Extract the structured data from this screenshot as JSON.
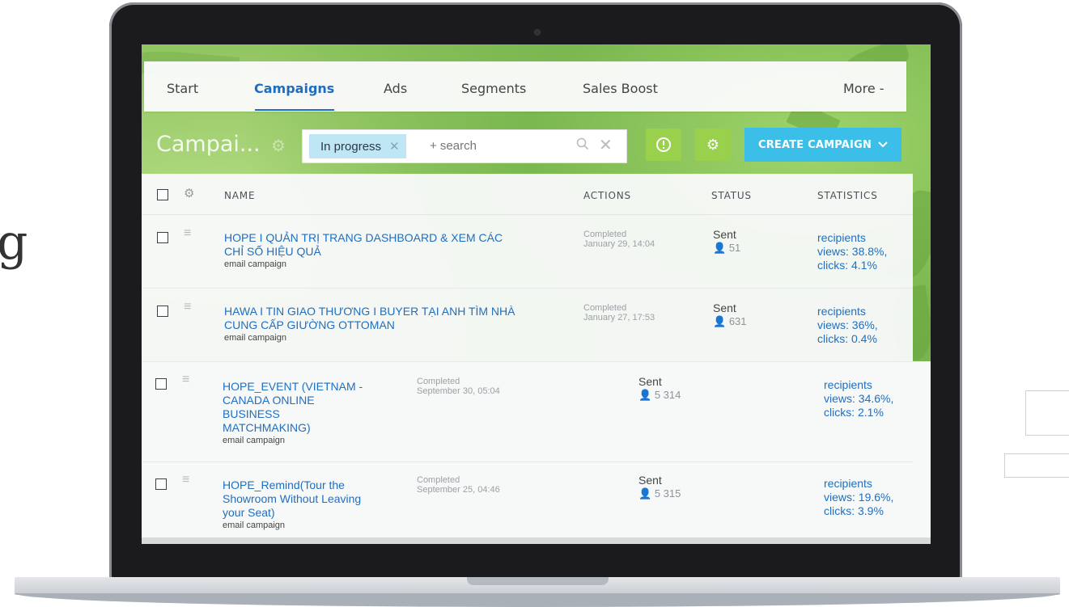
{
  "side_text": "g",
  "nav": {
    "items": [
      {
        "label": "Start"
      },
      {
        "label": "Campaigns"
      },
      {
        "label": "Ads"
      },
      {
        "label": "Segments"
      },
      {
        "label": "Sales Boost"
      },
      {
        "label": "More -"
      }
    ]
  },
  "header": {
    "title": "Campai...",
    "filter_chip": "In progress",
    "search_placeholder": "+ search",
    "create_button": "CREATE CAMPAIGN"
  },
  "table": {
    "columns": [
      "NAME",
      "ACTIONS",
      "STATUS",
      "STATISTICS"
    ],
    "rows": [
      {
        "name_line1": "HOPE I QUẢN TRỊ TRANG DASHBOARD & XEM CÁC",
        "name_line2": "CHỈ SỐ HIỆU QUẢ",
        "type": "email campaign",
        "action_status": "Completed",
        "action_date": "January 29, 14:04",
        "status": "Sent",
        "count": "51",
        "stat1": "recipients",
        "stat2": "views: 38.8%,",
        "stat3": "clicks: 4.1%"
      },
      {
        "name_line1": "HAWA I TIN GIAO THƯƠNG I BUYER TẠI ANH TÌM NHÀ",
        "name_line2": "CUNG CẤP GIƯỜNG OTTOMAN",
        "type": "email campaign",
        "action_status": "Completed",
        "action_date": "January 27, 17:53",
        "status": "Sent",
        "count": "631",
        "stat1": "recipients",
        "stat2": "views: 36%,",
        "stat3": "clicks: 0.4%"
      },
      {
        "name_line1": "HOPE_EVENT (VIETNAM -",
        "name_line2": "CANADA ONLINE",
        "name_line3": "BUSINESS",
        "name_line4": "MATCHMAKING)",
        "type": "email campaign",
        "action_status": "Completed",
        "action_date": "September 30, 05:04",
        "status": "Sent",
        "count": "5 314",
        "stat1": "recipients",
        "stat2": "views: 34.6%,",
        "stat3": "clicks: 2.1%"
      },
      {
        "name_line1": "HOPE_Remind(Tour the",
        "name_line2": "Showroom Without Leaving",
        "name_line3": "your Seat)",
        "type": "email campaign",
        "action_status": "Completed",
        "action_date": "September 25, 04:46",
        "status": "Sent",
        "count": "5 315",
        "stat1": "recipients",
        "stat2": "views: 19.6%,",
        "stat3": "clicks: 3.9%"
      }
    ]
  },
  "colors": {
    "accent": "#1d6ec2",
    "create_button": "#3bbfe8",
    "green_button": "#9ad14c",
    "chip": "#bfe6f4"
  }
}
